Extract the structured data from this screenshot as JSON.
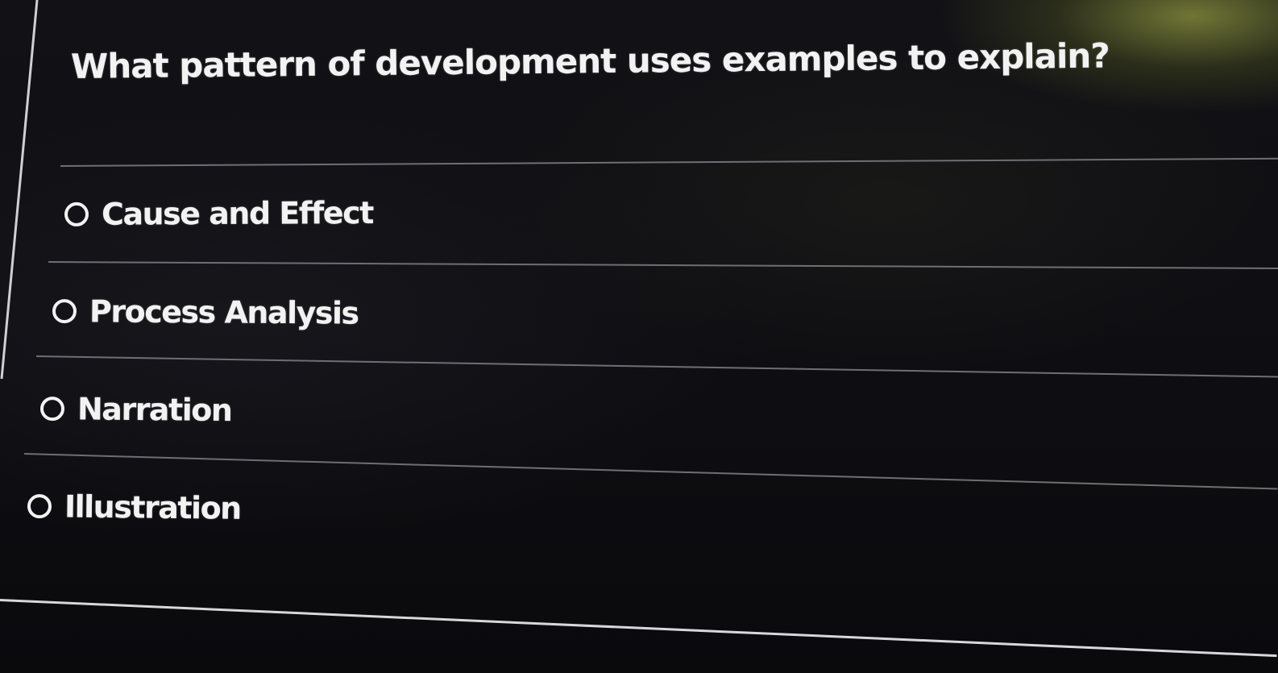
{
  "quiz": {
    "question": "What pattern of development uses examples to explain?",
    "options": [
      {
        "label": "Cause and Effect",
        "selected": false
      },
      {
        "label": "Process Analysis",
        "selected": false
      },
      {
        "label": "Narration",
        "selected": false
      },
      {
        "label": "Illustration",
        "selected": false
      }
    ]
  },
  "colors": {
    "background": "#0c0c0f",
    "text": "#f2f2f2",
    "divider": "#6e6e74"
  }
}
